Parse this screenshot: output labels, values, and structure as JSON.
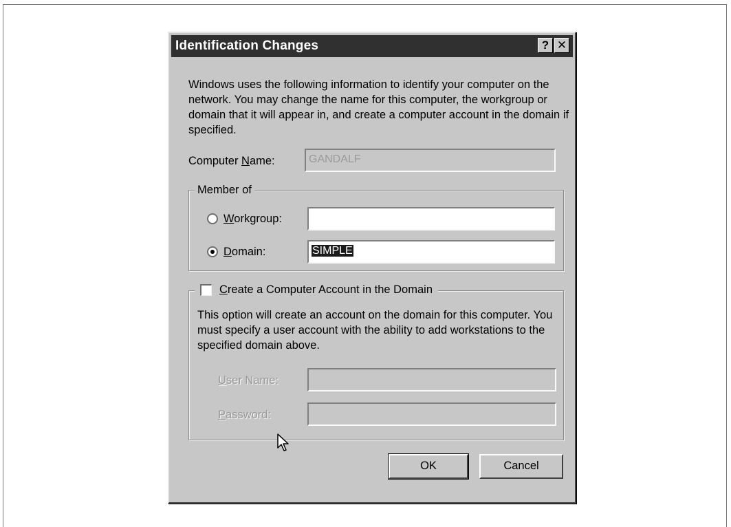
{
  "dialog": {
    "title": "Identification Changes",
    "help_glyph": "?",
    "close_glyph": "✕",
    "description": "Windows uses the following information to identify your computer on the network.  You may change the name for this computer, the workgroup or domain that it will appear in, and create a computer account in the domain if specified."
  },
  "computer_name": {
    "label_pre": "Computer ",
    "label_mnemonic": "N",
    "label_post": "ame:",
    "value": "GANDALF"
  },
  "member_of": {
    "legend": "Member of",
    "workgroup": {
      "mnemonic": "W",
      "label_post": "orkgroup:",
      "value": "",
      "selected": false
    },
    "domain": {
      "mnemonic": "D",
      "label_post": "omain:",
      "value": "SIMPLE",
      "selected": true
    }
  },
  "account": {
    "checkbox_mnemonic": "C",
    "checkbox_label_post": "reate a Computer Account in the Domain",
    "checked": false,
    "description": "This option will create an account on the domain for this computer.  You must specify a user account with the ability to add workstations to the specified domain above.",
    "user_name_mnemonic": "U",
    "user_name_label_post": "ser Name:",
    "user_name_value": "",
    "password_mnemonic": "P",
    "password_label_post": "assword:",
    "password_value": ""
  },
  "buttons": {
    "ok": "OK",
    "cancel": "Cancel"
  },
  "icons": [
    "help-icon",
    "close-icon",
    "mouse-pointer-icon"
  ]
}
